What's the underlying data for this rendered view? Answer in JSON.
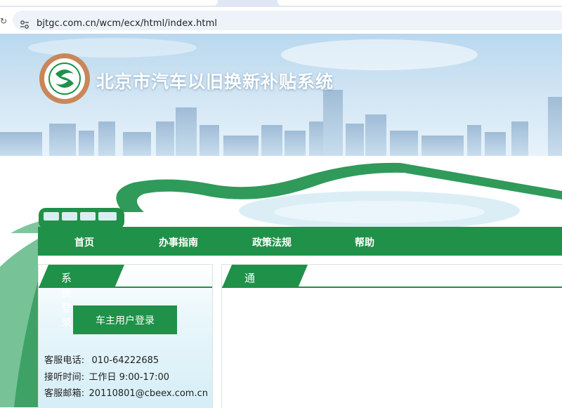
{
  "browser": {
    "url": "bjtgc.com.cn/wcm/ecx/html/index.html"
  },
  "header": {
    "title": "北京市汽车以旧换新补贴系统",
    "logo_icon": "emblem-logo-icon",
    "brand_color": "#1f9148"
  },
  "nav": {
    "items": [
      {
        "label": "首页"
      },
      {
        "label": "办事指南"
      },
      {
        "label": "政策法规"
      },
      {
        "label": "帮助"
      }
    ]
  },
  "login_panel": {
    "title": "系统登录",
    "button_label": "车主用户登录",
    "phone_label": "客服电话:",
    "phone": "010-64222685",
    "hours_label": "接听时间:",
    "hours": "工作日 9:00-17:00",
    "email_label": "客服邮箱:",
    "email": "20110801@cbeex.com.cn"
  },
  "notice_panel": {
    "title": "通知公告"
  }
}
